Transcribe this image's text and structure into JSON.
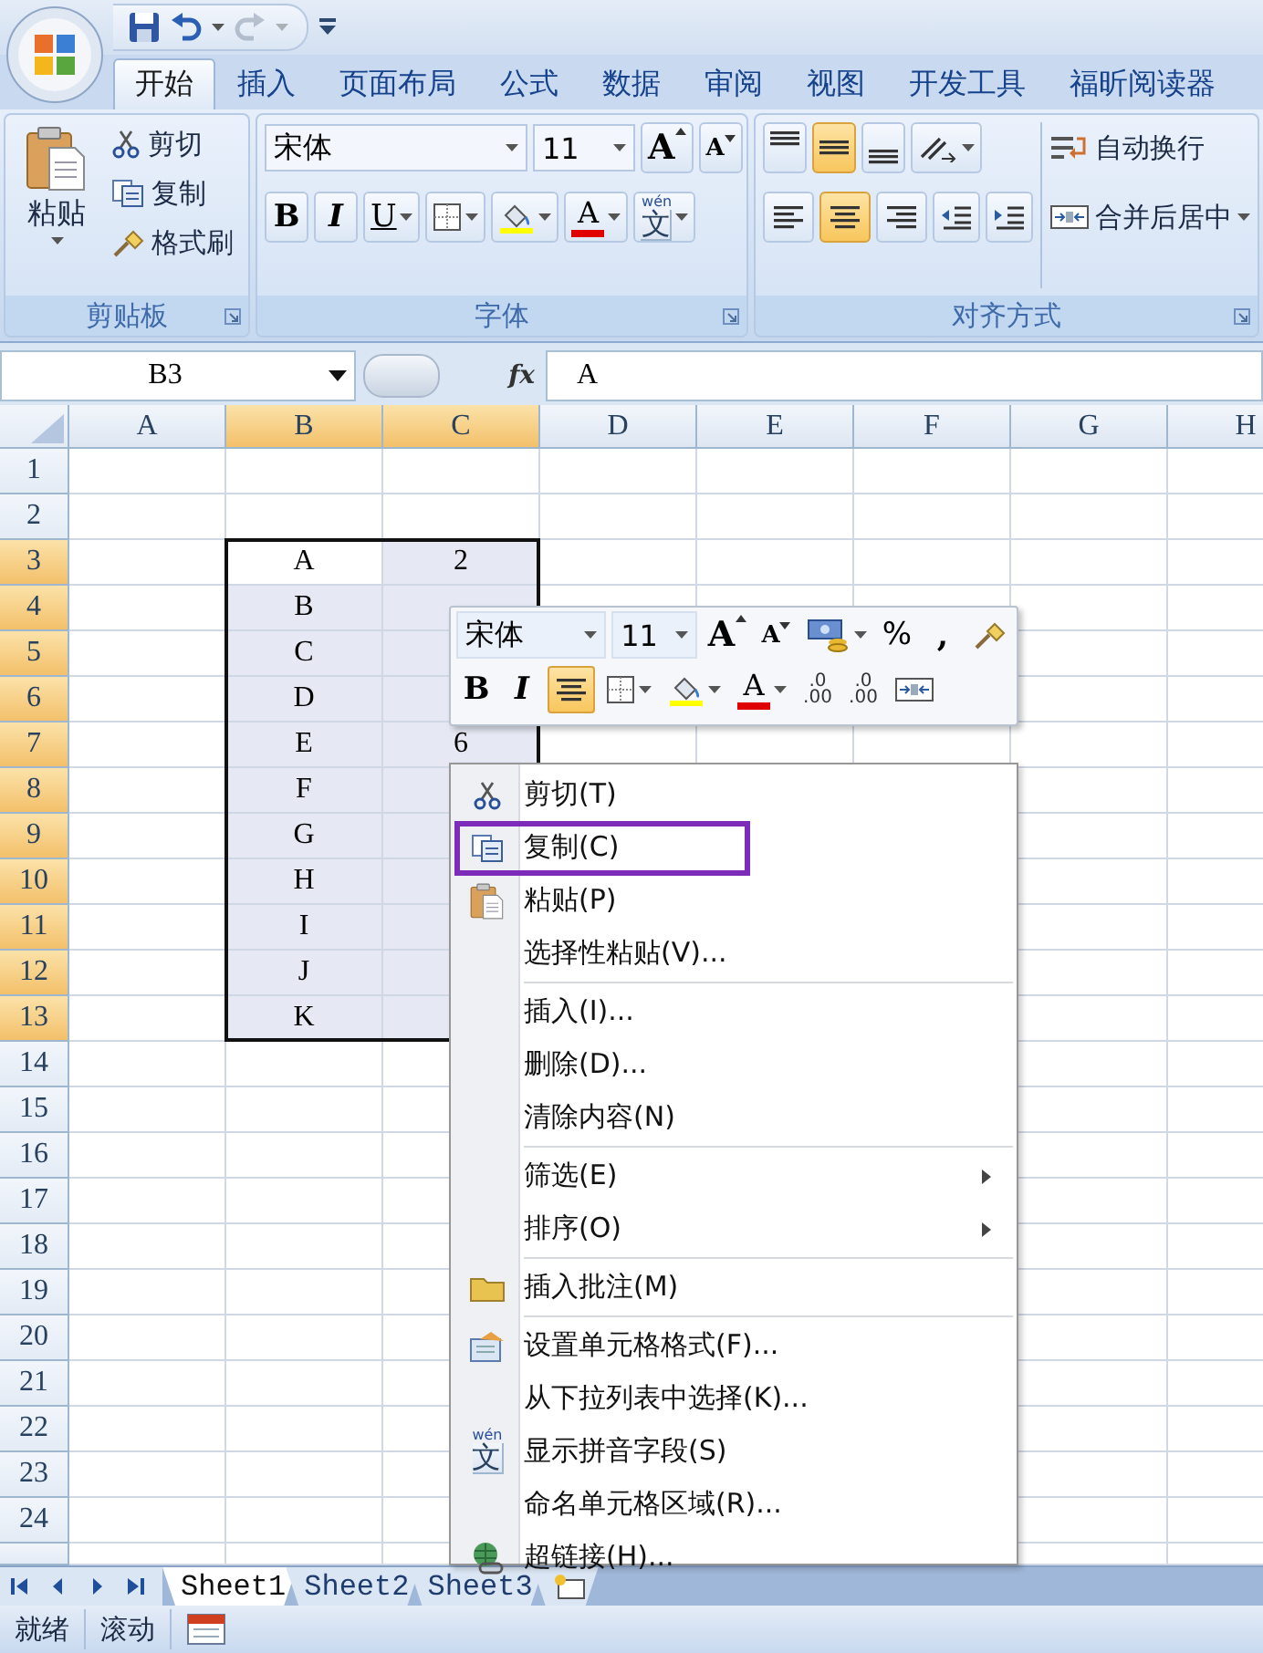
{
  "title_bar": {
    "redo_disabled": true
  },
  "ribbon": {
    "tabs": [
      {
        "label": "开始",
        "selected": true
      },
      {
        "label": "插入",
        "selected": false
      },
      {
        "label": "页面布局",
        "selected": false
      },
      {
        "label": "公式",
        "selected": false
      },
      {
        "label": "数据",
        "selected": false
      },
      {
        "label": "审阅",
        "selected": false
      },
      {
        "label": "视图",
        "selected": false
      },
      {
        "label": "开发工具",
        "selected": false
      },
      {
        "label": "福昕阅读器",
        "selected": false
      }
    ],
    "clipboard": {
      "label": "剪贴板",
      "paste": "粘贴",
      "commands": [
        "剪切",
        "复制",
        "格式刷"
      ]
    },
    "font": {
      "label": "字体",
      "font_name": "宋体",
      "font_size": "11",
      "grow": "A",
      "shrink": "A",
      "bold": "B",
      "italic": "I",
      "underline": "U",
      "font_color": "A",
      "phonetic": {
        "pinyin": "wén",
        "character": "文"
      }
    },
    "alignment": {
      "label": "对齐方式",
      "vertical": [
        {
          "selected": false
        },
        {
          "selected": true
        },
        {
          "selected": false
        }
      ],
      "horizontal": [
        {
          "selected": false
        },
        {
          "selected": true
        },
        {
          "selected": false
        }
      ],
      "wrap_text": "自动换行",
      "merge_center": "合并后居中"
    }
  },
  "formula_bar": {
    "name_box": "B3",
    "function_label": "fx",
    "value": "A"
  },
  "sheet": {
    "columns": [
      {
        "label": "A",
        "selected": false
      },
      {
        "label": "B",
        "selected": true
      },
      {
        "label": "C",
        "selected": true
      },
      {
        "label": "D",
        "selected": false
      },
      {
        "label": "E",
        "selected": false
      },
      {
        "label": "F",
        "selected": false
      },
      {
        "label": "G",
        "selected": false
      },
      {
        "label": "H",
        "selected": false
      }
    ],
    "rows": [
      {
        "label": "1",
        "selected": false
      },
      {
        "label": "2",
        "selected": false
      },
      {
        "label": "3",
        "selected": true,
        "cells": [
          null,
          "A",
          "2"
        ]
      },
      {
        "label": "4",
        "selected": true,
        "cells": [
          null,
          "B"
        ]
      },
      {
        "label": "5",
        "selected": true,
        "cells": [
          null,
          "C"
        ]
      },
      {
        "label": "6",
        "selected": true,
        "cells": [
          null,
          "D"
        ]
      },
      {
        "label": "7",
        "selected": true,
        "cells": [
          null,
          "E",
          "6"
        ]
      },
      {
        "label": "8",
        "selected": true,
        "cells": [
          null,
          "F"
        ]
      },
      {
        "label": "9",
        "selected": true,
        "cells": [
          null,
          "G"
        ]
      },
      {
        "label": "10",
        "selected": true,
        "cells": [
          null,
          "H"
        ]
      },
      {
        "label": "11",
        "selected": true,
        "cells": [
          null,
          "I"
        ]
      },
      {
        "label": "12",
        "selected": true,
        "cells": [
          null,
          "J"
        ]
      },
      {
        "label": "13",
        "selected": true,
        "cells": [
          null,
          "K"
        ]
      },
      {
        "label": "14",
        "selected": false
      },
      {
        "label": "15",
        "selected": false
      },
      {
        "label": "16",
        "selected": false
      },
      {
        "label": "17",
        "selected": false
      },
      {
        "label": "18",
        "selected": false
      },
      {
        "label": "19",
        "selected": false
      },
      {
        "label": "20",
        "selected": false
      },
      {
        "label": "21",
        "selected": false
      },
      {
        "label": "22",
        "selected": false
      },
      {
        "label": "23",
        "selected": false
      },
      {
        "label": "24",
        "selected": false
      }
    ]
  },
  "mini_toolbar": {
    "font_name": "宋体",
    "font_size": "11",
    "grow": "A",
    "shrink": "A",
    "percent": "%",
    "comma": ",",
    "bold": "B",
    "italic": "I",
    "center": {
      "selected": true
    },
    "font_color": "A",
    "increase_decimal": {
      "top": ".0",
      "bottom": ".00"
    },
    "decrease_decimal": {
      "top": ".0",
      "bottom": ".00"
    }
  },
  "context_menu": {
    "groups": [
      {
        "items": [
          {
            "label": "剪切(T)",
            "marked": false,
            "submenu": false
          },
          {
            "label": "复制(C)",
            "marked": true,
            "submenu": false
          },
          {
            "label": "粘贴(P)",
            "marked": false,
            "submenu": false
          },
          {
            "label": "选择性粘贴(V)...",
            "marked": false,
            "submenu": false
          }
        ]
      },
      {
        "items": [
          {
            "label": "插入(I)...",
            "marked": false,
            "submenu": false
          },
          {
            "label": "删除(D)...",
            "marked": false,
            "submenu": false
          },
          {
            "label": "清除内容(N)",
            "marked": false,
            "submenu": false
          }
        ]
      },
      {
        "items": [
          {
            "label": "筛选(E)",
            "marked": false,
            "submenu": true
          },
          {
            "label": "排序(O)",
            "marked": false,
            "submenu": true
          }
        ]
      },
      {
        "items": [
          {
            "label": "插入批注(M)",
            "marked": false,
            "submenu": false
          }
        ]
      },
      {
        "items": [
          {
            "label": "设置单元格格式(F)...",
            "marked": false,
            "submenu": false
          },
          {
            "label": "从下拉列表中选择(K)...",
            "marked": false,
            "submenu": false
          },
          {
            "label": "显示拼音字段(S)",
            "marked": false,
            "submenu": false,
            "icon_text": {
              "pinyin": "wén",
              "character": "文"
            }
          },
          {
            "label": "命名单元格区域(R)...",
            "marked": false,
            "submenu": false
          },
          {
            "label": "超链接(H)...",
            "marked": false,
            "submenu": false
          }
        ]
      }
    ]
  },
  "sheet_tabs": [
    {
      "label": "Sheet1",
      "selected": true
    },
    {
      "label": "Sheet2",
      "selected": false
    },
    {
      "label": "Sheet3",
      "selected": false
    }
  ],
  "status_bar": [
    "就绪",
    "滚动"
  ]
}
